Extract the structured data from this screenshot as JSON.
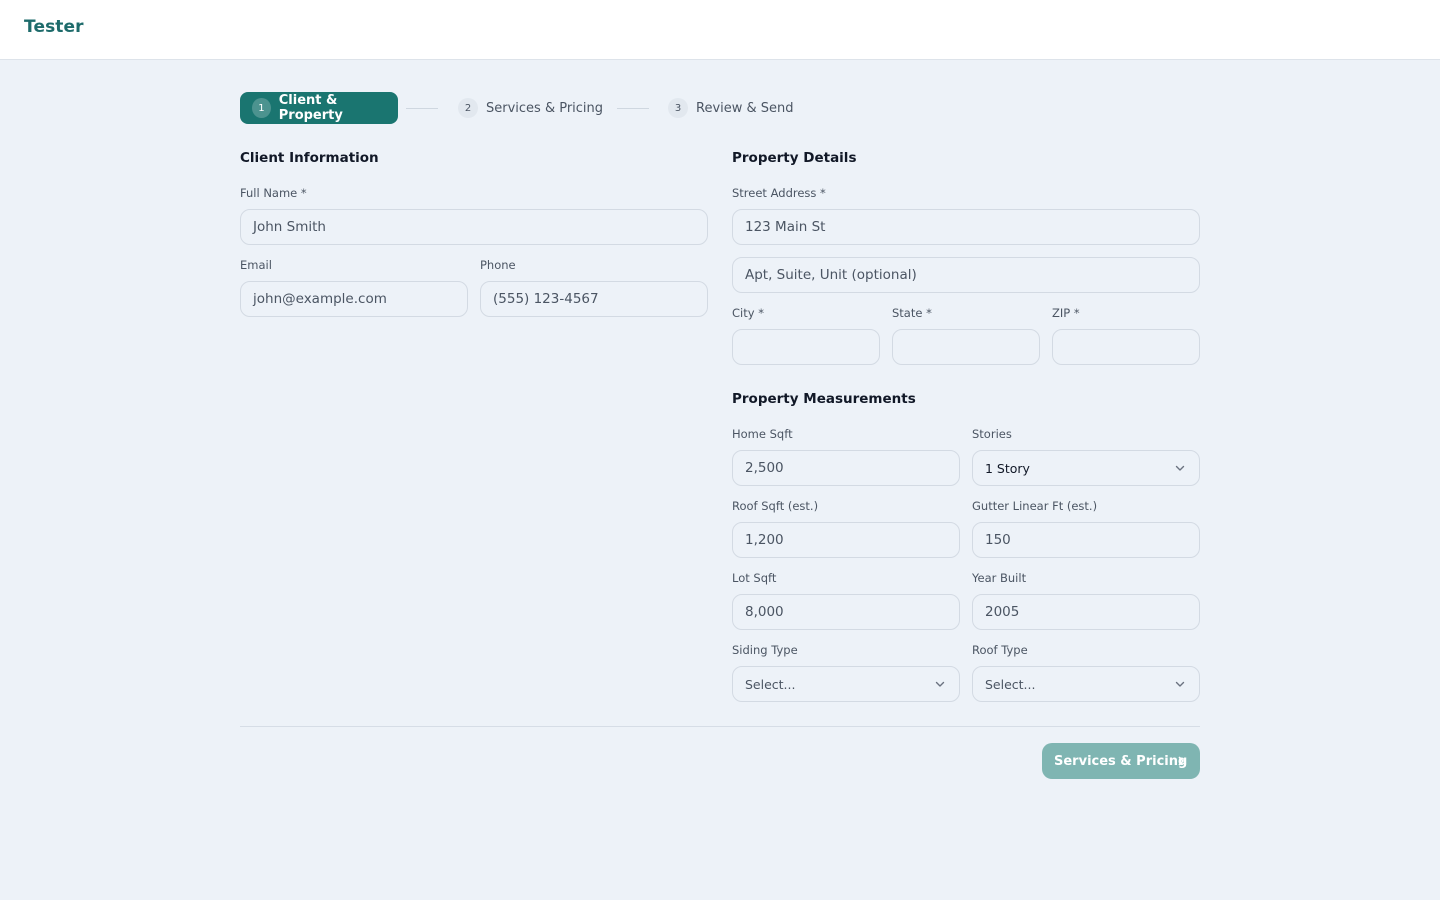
{
  "app": {
    "brand": "Tester"
  },
  "stepper": {
    "steps": [
      {
        "number": "1",
        "label": "Client & Property"
      },
      {
        "number": "2",
        "label": "Services & Pricing"
      },
      {
        "number": "3",
        "label": "Review & Send"
      }
    ]
  },
  "client": {
    "title": "Client Information",
    "full_name_label": "Full Name *",
    "full_name_placeholder": "John Smith",
    "email_label": "Email",
    "email_placeholder": "john@example.com",
    "phone_label": "Phone",
    "phone_placeholder": "(555) 123-4567"
  },
  "property": {
    "title": "Property Details",
    "street_label": "Street Address *",
    "street_placeholder": "123 Main St",
    "apt_placeholder": "Apt, Suite, Unit (optional)",
    "city_label": "City *",
    "city_value": "",
    "state_label": "State *",
    "state_value": "",
    "zip_label": "ZIP *",
    "zip_value": ""
  },
  "measurements": {
    "title": "Property Measurements",
    "home_sqft_label": "Home Sqft",
    "home_sqft_placeholder": "2,500",
    "stories_label": "Stories",
    "stories_value": "1 Story",
    "roof_sqft_label": "Roof Sqft (est.)",
    "roof_sqft_placeholder": "1,200",
    "gutter_label": "Gutter Linear Ft (est.)",
    "gutter_placeholder": "150",
    "lot_sqft_label": "Lot Sqft",
    "lot_sqft_placeholder": "8,000",
    "year_built_label": "Year Built",
    "year_built_placeholder": "2005",
    "siding_label": "Siding Type",
    "siding_value": "Select...",
    "roof_type_label": "Roof Type",
    "roof_type_value": "Select..."
  },
  "footer": {
    "next_label": "Services & Pricing"
  },
  "colors": {
    "accent": "#1a7570",
    "button_disabled": "#7fb5b2",
    "background": "#edf2f8"
  },
  "icons": {
    "dropdown": "chevron-down-icon",
    "next": "chevron-right-icon"
  }
}
